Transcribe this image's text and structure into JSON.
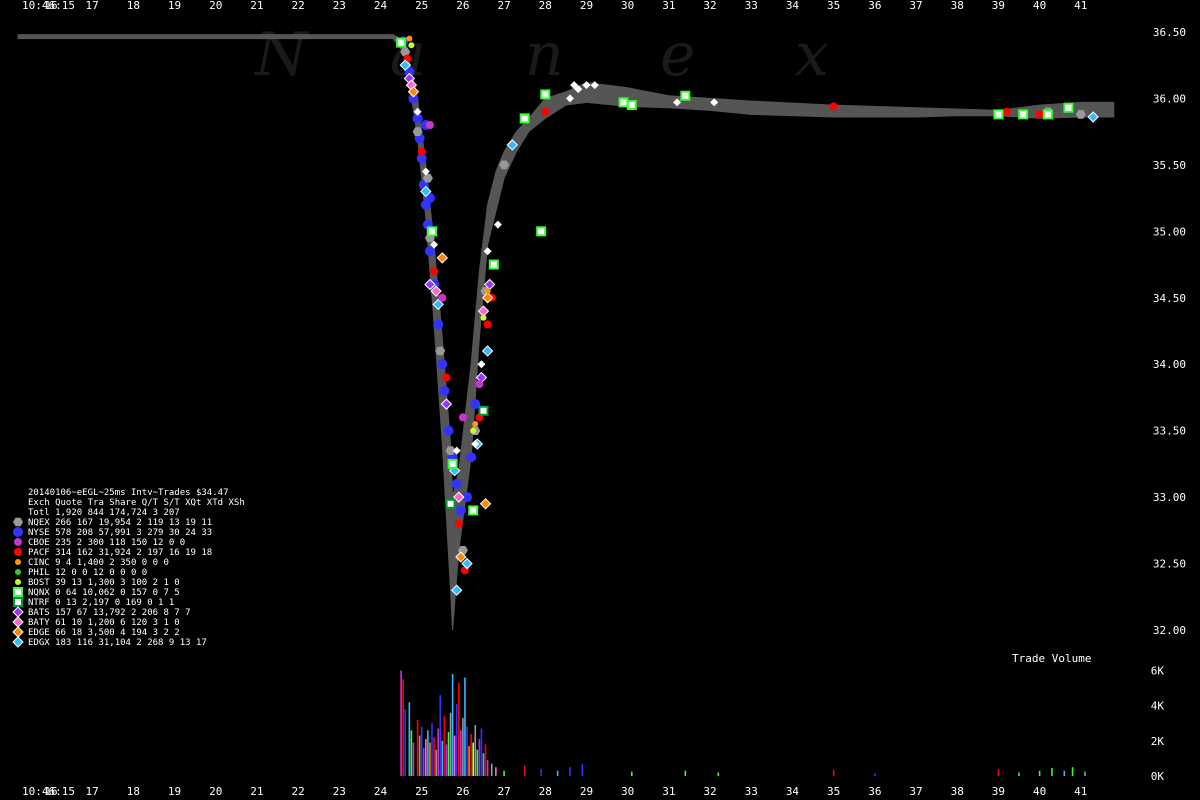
{
  "time_label": "10:46:15",
  "x_tick_labels": [
    "16",
    "17",
    "18",
    "19",
    "20",
    "21",
    "22",
    "23",
    "24",
    "25",
    "26",
    "27",
    "28",
    "29",
    "30",
    "31",
    "32",
    "33",
    "34",
    "35",
    "36",
    "37",
    "38",
    "39",
    "40",
    "41"
  ],
  "y_tick_labels": [
    "36.50",
    "36.00",
    "35.50",
    "35.00",
    "34.50",
    "34.00",
    "33.50",
    "33.00",
    "32.50",
    "32.00"
  ],
  "vol_tick_labels": [
    "6K",
    "4K",
    "2K",
    "0K"
  ],
  "watermark": [
    "N",
    "a",
    "n",
    "e",
    "x"
  ],
  "volume_title": "Trade Volume",
  "legend": {
    "title": "20140106~eEGL~25ms Intv~Trades $34.47",
    "header": "Exch Quote Tra   Share  Q/T   S/T  XQt XTd XSh",
    "total": "Totl 1,920 844 174,724    3   207",
    "rows": [
      {
        "exch": "NQEX",
        "text": "NQEX   266 167  19,954    2   119  13  19  11",
        "color": "#999999",
        "shape": "hex"
      },
      {
        "exch": "NYSE",
        "text": "NYSE   578 208  57,991    3   279  30  24  33",
        "color": "#3333ff",
        "shape": "circle-big"
      },
      {
        "exch": "CBOE",
        "text": "CBOE   235   2     300  118   150  12   0   0",
        "color": "#cc33cc",
        "shape": "circle"
      },
      {
        "exch": "PACF",
        "text": "PACF   314 162  31,924    2   197  16  19  18",
        "color": "#ff0000",
        "shape": "circle"
      },
      {
        "exch": "CINC",
        "text": "CINC     9   4   1,400    2   350   0   0   0",
        "color": "#ff9900",
        "shape": "circle-small"
      },
      {
        "exch": "PHIL",
        "text": "PHIL    12   0       0   12     0   0   0   0",
        "color": "#33cc33",
        "shape": "circle-small"
      },
      {
        "exch": "BOST",
        "text": "BOST    39  13   1,300    3   100   2   1   0",
        "color": "#ccff33",
        "shape": "circle-small"
      },
      {
        "exch": "NQNX",
        "text": "NQNX     0  64  10,062    0   157   0   7   5",
        "color": "#33ff33",
        "shape": "square"
      },
      {
        "exch": "NTRF",
        "text": "NTRF     0  13   2,197    0   169   0   1   1",
        "color": "#009933",
        "shape": "square"
      },
      {
        "exch": "BATS",
        "text": "BATS   157  67  13,792    2   206   8   7   7",
        "color": "#9933ff",
        "shape": "diamond"
      },
      {
        "exch": "BATY",
        "text": "BATY    61  10   1,200    6   120   3   1   0",
        "color": "#ff66cc",
        "shape": "diamond"
      },
      {
        "exch": "EDGE",
        "text": "EDGE    66  18   3,500    4   194   3   2   2",
        "color": "#ff8800",
        "shape": "diamond"
      },
      {
        "exch": "EDGX",
        "text": "EDGX   183 116  31,104    2   268   9  13  17",
        "color": "#33bbff",
        "shape": "diamond"
      }
    ]
  },
  "chart_data": {
    "type": "scatter",
    "x_axis": "seconds",
    "xlim": [
      15.2,
      42.0
    ],
    "ylim": [
      31.85,
      36.62
    ],
    "vol_ylim": [
      0,
      6600
    ],
    "nbbo_band": [
      [
        15.2,
        36.48,
        36.45
      ],
      [
        24.3,
        36.48,
        36.45
      ],
      [
        24.6,
        36.43,
        36.33
      ],
      [
        24.9,
        36.0,
        35.7
      ],
      [
        25.1,
        35.5,
        35.1
      ],
      [
        25.3,
        34.9,
        34.3
      ],
      [
        25.5,
        34.2,
        33.4
      ],
      [
        25.7,
        33.4,
        32.3
      ],
      [
        25.75,
        33.0,
        32.0
      ],
      [
        25.9,
        33.2,
        32.6
      ],
      [
        26.2,
        34.0,
        33.3
      ],
      [
        26.4,
        34.7,
        34.2
      ],
      [
        26.6,
        35.2,
        34.9
      ],
      [
        26.8,
        35.45,
        35.15
      ],
      [
        27.0,
        35.6,
        35.4
      ],
      [
        27.3,
        35.75,
        35.6
      ],
      [
        27.6,
        35.85,
        35.75
      ],
      [
        28.0,
        36.0,
        35.85
      ],
      [
        28.5,
        36.05,
        35.95
      ],
      [
        29.0,
        36.12,
        35.97
      ],
      [
        30.0,
        36.08,
        35.94
      ],
      [
        31.0,
        36.02,
        35.93
      ],
      [
        32.0,
        36.0,
        35.91
      ],
      [
        33.0,
        35.98,
        35.88
      ],
      [
        35.0,
        35.95,
        35.86
      ],
      [
        37.0,
        35.93,
        35.86
      ],
      [
        38.0,
        35.92,
        35.87
      ],
      [
        39.0,
        35.91,
        35.87
      ],
      [
        40.0,
        35.95,
        35.85
      ],
      [
        41.0,
        35.97,
        35.86
      ],
      [
        41.8,
        35.97,
        35.86
      ]
    ],
    "trades": [
      {
        "exch": "NYSE",
        "points": [
          [
            24.55,
            36.43
          ],
          [
            24.7,
            36.2
          ],
          [
            24.8,
            36.0
          ],
          [
            24.9,
            35.85
          ],
          [
            24.95,
            35.7
          ],
          [
            25.0,
            35.55
          ],
          [
            25.05,
            35.35
          ],
          [
            25.1,
            35.2
          ],
          [
            25.15,
            35.05
          ],
          [
            25.2,
            34.85
          ],
          [
            25.3,
            34.6
          ],
          [
            25.4,
            34.3
          ],
          [
            25.5,
            34.0
          ],
          [
            25.55,
            33.8
          ],
          [
            25.65,
            33.5
          ],
          [
            25.75,
            33.3
          ],
          [
            25.85,
            33.1
          ],
          [
            25.95,
            32.9
          ],
          [
            26.1,
            33.0
          ],
          [
            26.2,
            33.3
          ],
          [
            26.3,
            33.7
          ],
          [
            25.1,
            35.8
          ],
          [
            25.2,
            35.25
          ]
        ]
      },
      {
        "exch": "NQEX",
        "points": [
          [
            24.6,
            36.35
          ],
          [
            24.9,
            35.75
          ],
          [
            25.2,
            34.95
          ],
          [
            25.45,
            34.1
          ],
          [
            25.7,
            33.35
          ],
          [
            26.0,
            32.6
          ],
          [
            26.3,
            33.5
          ],
          [
            26.55,
            34.55
          ],
          [
            27.0,
            35.5
          ],
          [
            41.0,
            35.88
          ],
          [
            40.2,
            35.9
          ],
          [
            25.15,
            35.4
          ]
        ]
      },
      {
        "exch": "PACF",
        "points": [
          [
            24.65,
            36.3
          ],
          [
            25.0,
            35.6
          ],
          [
            25.3,
            34.7
          ],
          [
            25.6,
            33.9
          ],
          [
            25.9,
            32.8
          ],
          [
            26.05,
            32.45
          ],
          [
            26.4,
            33.6
          ],
          [
            26.6,
            34.3
          ],
          [
            26.7,
            34.5
          ],
          [
            28.0,
            35.9
          ],
          [
            35.0,
            35.94
          ],
          [
            39.2,
            35.9
          ],
          [
            40.0,
            35.88
          ]
        ]
      },
      {
        "exch": "EDGX",
        "points": [
          [
            24.6,
            36.25
          ],
          [
            25.1,
            35.3
          ],
          [
            25.4,
            34.45
          ],
          [
            25.8,
            33.2
          ],
          [
            25.85,
            32.3
          ],
          [
            26.1,
            32.5
          ],
          [
            26.35,
            33.4
          ],
          [
            26.6,
            34.1
          ],
          [
            27.2,
            35.65
          ],
          [
            41.3,
            35.86
          ]
        ]
      },
      {
        "exch": "NQNX",
        "points": [
          [
            24.5,
            36.42
          ],
          [
            25.25,
            35.0
          ],
          [
            25.75,
            33.25
          ],
          [
            26.25,
            32.9
          ],
          [
            26.75,
            34.75
          ],
          [
            27.5,
            35.85
          ],
          [
            28.0,
            36.03
          ],
          [
            29.9,
            35.97
          ],
          [
            30.1,
            35.95
          ],
          [
            31.4,
            36.02
          ],
          [
            39.0,
            35.88
          ],
          [
            39.6,
            35.88
          ],
          [
            40.7,
            35.93
          ],
          [
            27.9,
            35.0
          ],
          [
            40.2,
            35.88
          ]
        ]
      },
      {
        "exch": "BATS",
        "points": [
          [
            24.7,
            36.15
          ],
          [
            25.2,
            34.6
          ],
          [
            25.6,
            33.7
          ],
          [
            26.45,
            33.9
          ],
          [
            26.65,
            34.6
          ]
        ]
      },
      {
        "exch": "BATY",
        "points": [
          [
            24.75,
            36.1
          ],
          [
            25.35,
            34.55
          ],
          [
            25.9,
            33.0
          ],
          [
            26.5,
            34.4
          ]
        ]
      },
      {
        "exch": "EDGE",
        "points": [
          [
            24.8,
            36.05
          ],
          [
            25.5,
            34.8
          ],
          [
            25.95,
            32.55
          ],
          [
            26.55,
            32.95
          ],
          [
            26.6,
            34.5
          ]
        ]
      },
      {
        "exch": "CINC",
        "points": [
          [
            24.7,
            36.45
          ],
          [
            26.3,
            33.55
          ],
          [
            26.6,
            34.55
          ]
        ]
      },
      {
        "exch": "BOST",
        "points": [
          [
            24.75,
            36.4
          ],
          [
            26.25,
            33.5
          ],
          [
            26.5,
            34.35
          ]
        ]
      },
      {
        "exch": "CBOE",
        "points": [
          [
            25.2,
            35.8
          ],
          [
            25.5,
            34.5
          ],
          [
            26.0,
            33.6
          ],
          [
            26.4,
            33.85
          ]
        ]
      },
      {
        "exch": "NTRF",
        "points": [
          [
            25.7,
            32.95
          ],
          [
            26.5,
            33.65
          ]
        ]
      }
    ],
    "white_markers": [
      [
        24.9,
        35.9
      ],
      [
        25.1,
        35.45
      ],
      [
        25.3,
        34.9
      ],
      [
        26.45,
        34.0
      ],
      [
        26.6,
        34.85
      ],
      [
        26.85,
        35.05
      ],
      [
        28.7,
        36.1
      ],
      [
        28.8,
        36.07
      ],
      [
        29.0,
        36.1
      ],
      [
        29.2,
        36.1
      ],
      [
        28.6,
        36.0
      ],
      [
        31.2,
        35.97
      ],
      [
        32.1,
        35.97
      ],
      [
        26.3,
        33.4
      ],
      [
        25.85,
        33.35
      ]
    ],
    "volume": [
      {
        "t": 24.5,
        "v": 6000,
        "c": "#cc33cc"
      },
      {
        "t": 24.55,
        "v": 5500,
        "c": "#ff0000"
      },
      {
        "t": 24.6,
        "v": 3800,
        "c": "#3333ff"
      },
      {
        "t": 24.7,
        "v": 4200,
        "c": "#33bbff"
      },
      {
        "t": 24.75,
        "v": 2600,
        "c": "#33ff33"
      },
      {
        "t": 24.8,
        "v": 1900,
        "c": "#cc33cc"
      },
      {
        "t": 24.9,
        "v": 3200,
        "c": "#ff0000"
      },
      {
        "t": 24.95,
        "v": 2300,
        "c": "#999999"
      },
      {
        "t": 25.0,
        "v": 2800,
        "c": "#3333ff"
      },
      {
        "t": 25.05,
        "v": 1600,
        "c": "#9933ff"
      },
      {
        "t": 25.1,
        "v": 2100,
        "c": "#ff66cc"
      },
      {
        "t": 25.15,
        "v": 2600,
        "c": "#33bbff"
      },
      {
        "t": 25.2,
        "v": 1900,
        "c": "#ff8800"
      },
      {
        "t": 25.25,
        "v": 3000,
        "c": "#3333ff"
      },
      {
        "t": 25.3,
        "v": 2200,
        "c": "#ff0000"
      },
      {
        "t": 25.35,
        "v": 1500,
        "c": "#999999"
      },
      {
        "t": 25.4,
        "v": 2700,
        "c": "#cc33cc"
      },
      {
        "t": 25.45,
        "v": 4600,
        "c": "#3333ff"
      },
      {
        "t": 25.5,
        "v": 2000,
        "c": "#33bbff"
      },
      {
        "t": 25.55,
        "v": 3400,
        "c": "#ff0000"
      },
      {
        "t": 25.6,
        "v": 1800,
        "c": "#9933ff"
      },
      {
        "t": 25.65,
        "v": 2500,
        "c": "#33ff33"
      },
      {
        "t": 25.7,
        "v": 3600,
        "c": "#999999"
      },
      {
        "t": 25.75,
        "v": 5800,
        "c": "#33bbff"
      },
      {
        "t": 25.8,
        "v": 2300,
        "c": "#ff66cc"
      },
      {
        "t": 25.85,
        "v": 4100,
        "c": "#3333ff"
      },
      {
        "t": 25.9,
        "v": 5300,
        "c": "#ff0000"
      },
      {
        "t": 25.95,
        "v": 2600,
        "c": "#cc33cc"
      },
      {
        "t": 26.0,
        "v": 3300,
        "c": "#999999"
      },
      {
        "t": 26.05,
        "v": 5600,
        "c": "#33bbff"
      },
      {
        "t": 26.1,
        "v": 2800,
        "c": "#3333ff"
      },
      {
        "t": 26.15,
        "v": 1700,
        "c": "#ff8800"
      },
      {
        "t": 26.2,
        "v": 2400,
        "c": "#ff0000"
      },
      {
        "t": 26.25,
        "v": 1900,
        "c": "#ccff33"
      },
      {
        "t": 26.3,
        "v": 2900,
        "c": "#999999"
      },
      {
        "t": 26.35,
        "v": 1500,
        "c": "#33ff33"
      },
      {
        "t": 26.4,
        "v": 2100,
        "c": "#9933ff"
      },
      {
        "t": 26.45,
        "v": 2700,
        "c": "#3333ff"
      },
      {
        "t": 26.5,
        "v": 1300,
        "c": "#33bbff"
      },
      {
        "t": 26.55,
        "v": 1800,
        "c": "#ff0000"
      },
      {
        "t": 26.6,
        "v": 900,
        "c": "#cc33cc"
      },
      {
        "t": 26.7,
        "v": 700,
        "c": "#999999"
      },
      {
        "t": 26.8,
        "v": 500,
        "c": "#ff66cc"
      },
      {
        "t": 27.0,
        "v": 300,
        "c": "#33ff33"
      },
      {
        "t": 27.5,
        "v": 600,
        "c": "#ff0000"
      },
      {
        "t": 27.9,
        "v": 400,
        "c": "#3333ff"
      },
      {
        "t": 28.3,
        "v": 300,
        "c": "#33bbff"
      },
      {
        "t": 28.6,
        "v": 500,
        "c": "#3333ff"
      },
      {
        "t": 28.9,
        "v": 700,
        "c": "#3333ff"
      },
      {
        "t": 30.1,
        "v": 250,
        "c": "#33ff33"
      },
      {
        "t": 31.4,
        "v": 300,
        "c": "#33ff33"
      },
      {
        "t": 32.2,
        "v": 200,
        "c": "#33ff33"
      },
      {
        "t": 35.0,
        "v": 350,
        "c": "#ff0000"
      },
      {
        "t": 36.0,
        "v": 150,
        "c": "#3333ff"
      },
      {
        "t": 39.0,
        "v": 400,
        "c": "#ff0000"
      },
      {
        "t": 39.5,
        "v": 200,
        "c": "#33ff33"
      },
      {
        "t": 40.0,
        "v": 300,
        "c": "#33ff33"
      },
      {
        "t": 40.3,
        "v": 450,
        "c": "#33ff33"
      },
      {
        "t": 40.6,
        "v": 300,
        "c": "#33bbff"
      },
      {
        "t": 40.8,
        "v": 500,
        "c": "#33ff33"
      },
      {
        "t": 41.1,
        "v": 250,
        "c": "#999999"
      }
    ]
  }
}
